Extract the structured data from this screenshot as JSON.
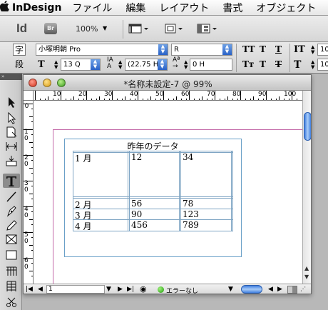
{
  "menubar": {
    "app_name": "InDesign",
    "items": [
      "ファイル",
      "編集",
      "レイアウト",
      "書式",
      "オブジェクト"
    ]
  },
  "appbar": {
    "logo": "Id",
    "bridge": "Br",
    "zoom": "100%"
  },
  "control": {
    "char_mode_label": "字",
    "para_mode_label": "段",
    "font_family": "小塚明朝 Pro",
    "font_style": "R",
    "font_size": "13 Q",
    "leading": "(22.75 H",
    "tracking": "0 H",
    "glyphs": {
      "all_caps": "TT",
      "superscript": "T",
      "underline": "T",
      "small_caps": "Tт",
      "subscript": "T",
      "strikethrough": "T"
    },
    "right_value_1": "10",
    "right_value_2": "10"
  },
  "document": {
    "title": "*名称未設定-7 @ 99%",
    "hruler_ticks": [
      "10",
      "20",
      "30",
      "40",
      "50",
      "60",
      "70",
      "80",
      "90",
      "100"
    ],
    "vruler_ticks": [
      "0",
      "1 0",
      "2 0",
      "3 0",
      "4 0",
      "5 0",
      "6 0"
    ],
    "table": {
      "caption": "昨年のデータ",
      "rows": [
        [
          "1 月",
          "12",
          "34"
        ],
        [
          "2 月",
          "56",
          "78"
        ],
        [
          "3 月",
          "90",
          "123"
        ],
        [
          "4 月",
          "456",
          "789"
        ]
      ]
    },
    "status": {
      "page": "1",
      "preflight": "エラーなし"
    }
  },
  "colors": {
    "text_frame": "#6aa0c8",
    "margin_guide": "#c46aa8",
    "table_border": "#7fa5c4",
    "scroll_thumb": "#3f7ee0"
  }
}
